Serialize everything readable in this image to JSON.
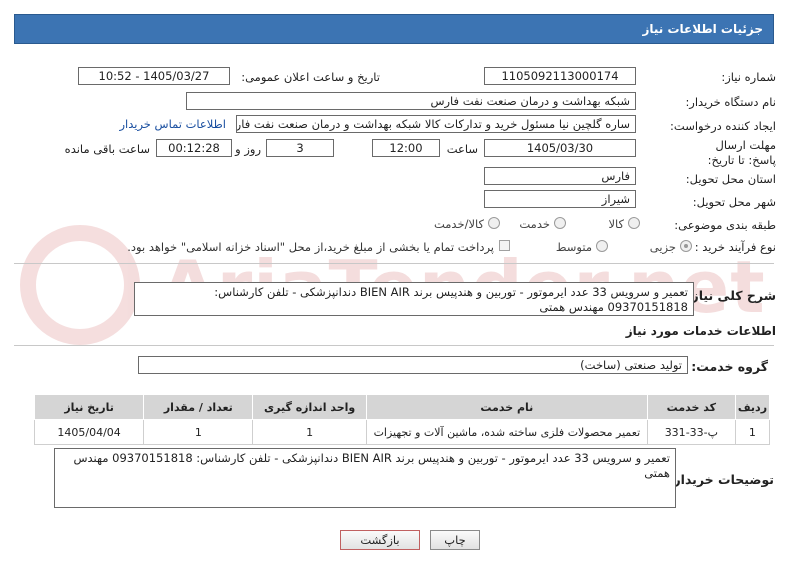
{
  "panel_title": "جزئیات اطلاعات نیاز",
  "fields": {
    "need_number_label": "شماره نیاز:",
    "need_number": "1105092113000174",
    "announce_label": "تاریخ و ساعت اعلان عمومی:",
    "announce_value": "1405/03/27 - 10:52",
    "buyer_org_label": "نام دستگاه خریدار:",
    "buyer_org": "شبکه بهداشت و درمان صنعت نفت فارس",
    "requester_label": "ایجاد کننده درخواست:",
    "requester": "ساره گلچین نیا مسئول خرید و تدارکات کالا شبکه بهداشت و درمان صنعت نفت فارس",
    "contact_link": "اطلاعات تماس خریدار",
    "deadline_label": "مهلت ارسال پاسخ: تا تاریخ:",
    "deadline_date": "1405/03/30",
    "time_label": "ساعت",
    "deadline_time": "12:00",
    "days_value": "3",
    "days_label": "روز و",
    "remaining_time": "00:12:28",
    "remaining_label": "ساعت باقی مانده",
    "province_label": "استان محل تحویل:",
    "province": "فارس",
    "city_label": "شهر محل تحویل:",
    "city": "شیراز",
    "category_label": "طبقه بندی موضوعی:",
    "category_options": [
      "کالا",
      "خدمت",
      "کالا/خدمت"
    ],
    "process_label": "نوع فرآیند خرید :",
    "process_options": [
      "جزیی",
      "متوسط"
    ],
    "payment_note": "پرداخت تمام یا بخشی از مبلغ خرید،از محل \"اسناد خزانه اسلامی\" خواهد بود."
  },
  "summary": {
    "label": "شرح کلی نیاز:",
    "text": "تعمیر و سرویس 33 عدد ایرموتور - توربین و هندپیس برند BIEN AIR دندانپزشکی - تلفن کارشناس: 09370151818 مهندس همتی"
  },
  "services": {
    "section_title": "اطلاعات خدمات مورد نیاز",
    "group_label": "گروه خدمت:",
    "group_value": "تولید صنعتی (ساخت)",
    "columns": [
      "ردیف",
      "کد خدمت",
      "نام خدمت",
      "واحد اندازه گیری",
      "تعداد / مقدار",
      "تاریخ نیاز"
    ],
    "rows": [
      [
        "1",
        "پ-33-331",
        "تعمیر محصولات فلزی ساخته شده، ماشین آلات و تجهیزات",
        "1",
        "1",
        "1405/04/04"
      ]
    ]
  },
  "buyer_notes": {
    "label": "توضیحات خریدار:",
    "text": "تعمیر و سرویس 33 عدد ایرموتور - توربین و هندپیس برند BIEN AIR دندانپزشکی - تلفن کارشناس: 09370151818 مهندس همتی"
  },
  "buttons": {
    "print": "چاپ",
    "back": "بازگشت"
  },
  "watermark": "AriaTender.net",
  "colors": {
    "header": "#3c74b3",
    "link": "#1a4fa0"
  }
}
